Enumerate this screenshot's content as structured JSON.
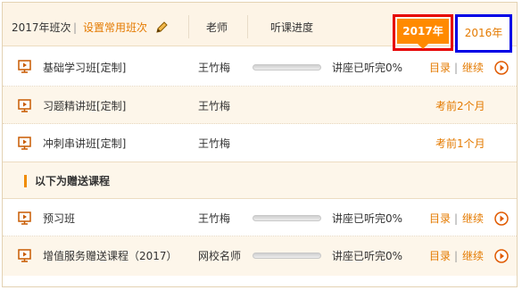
{
  "header": {
    "class_label": "2017年班次",
    "divider": "|",
    "set_common_label": "设置常用班次",
    "teacher_col": "老师",
    "progress_col": "听课进度",
    "tabs": [
      {
        "label": "2017年",
        "active": true
      },
      {
        "label": "2016年",
        "active": false
      }
    ]
  },
  "courses": [
    {
      "name": "基础学习班[定制]",
      "teacher": "王竹梅",
      "progress": 0,
      "status": "讲座已听完0%",
      "catalog": "目录",
      "sep": "|",
      "continue": "继续"
    },
    {
      "name": "习题精讲班[定制]",
      "teacher": "王竹梅",
      "upcoming": "考前2个月"
    },
    {
      "name": "冲刺串讲班[定制]",
      "teacher": "王竹梅",
      "upcoming": "考前1个月"
    }
  ],
  "bonus": {
    "title": "以下为赠送课程",
    "courses": [
      {
        "name": "预习班",
        "teacher": "王竹梅",
        "progress": 0,
        "status": "讲座已听完0%",
        "catalog": "目录",
        "sep": "|",
        "continue": "继续"
      },
      {
        "name": "增值服务赠送课程（2017）",
        "teacher": "网校名师",
        "progress": 0,
        "status": "讲座已听完0%",
        "catalog": "目录",
        "sep": "|",
        "continue": "继续"
      }
    ]
  },
  "colors": {
    "accent": "#ff8a00",
    "link": "#e47a00",
    "active_outline": "#e60000",
    "inactive_outline": "#0000e6"
  },
  "icons": {
    "course": "play-lesson-icon",
    "go": "play-circle-icon",
    "edit": "pencil-icon"
  }
}
